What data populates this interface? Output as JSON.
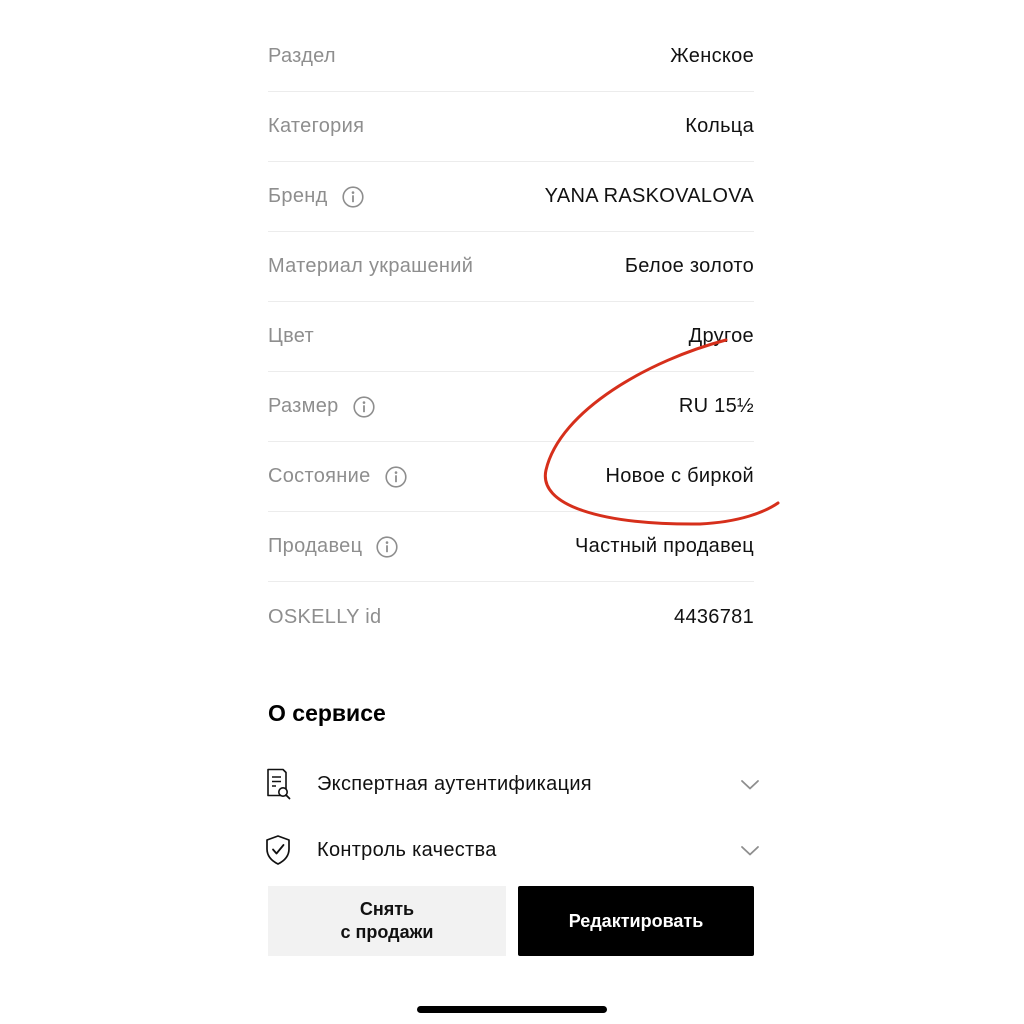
{
  "details": [
    {
      "label": "Раздел",
      "value": "Женское",
      "info": false
    },
    {
      "label": "Категория",
      "value": "Кольца",
      "info": false
    },
    {
      "label": "Бренд",
      "value": "YANA RASKOVALOVA",
      "info": true
    },
    {
      "label": "Материал украшений",
      "value": "Белое золото",
      "info": false
    },
    {
      "label": "Цвет",
      "value": "Другое",
      "info": false
    },
    {
      "label": "Размер",
      "value": "RU 15½",
      "info": true
    },
    {
      "label": "Состояние",
      "value": "Новое с биркой",
      "info": true
    },
    {
      "label": "Продавец",
      "value": "Частный продавец",
      "info": true
    },
    {
      "label": "OSKELLY id",
      "value": "4436781",
      "info": false
    }
  ],
  "service": {
    "title": "О сервисе",
    "items": [
      {
        "label": "Экспертная аутентификация",
        "icon": "document-search-icon"
      },
      {
        "label": "Контроль качества",
        "icon": "shield-check-icon"
      }
    ]
  },
  "actions": {
    "unpublish_label": "Снять\nс продажи",
    "edit_label": "Редактировать"
  },
  "colors": {
    "label_gray": "#8e8e8e",
    "divider": "#ececec",
    "primary_button": "#000000",
    "secondary_button": "#f2f2f2",
    "annotation_red": "#d62f1b"
  }
}
